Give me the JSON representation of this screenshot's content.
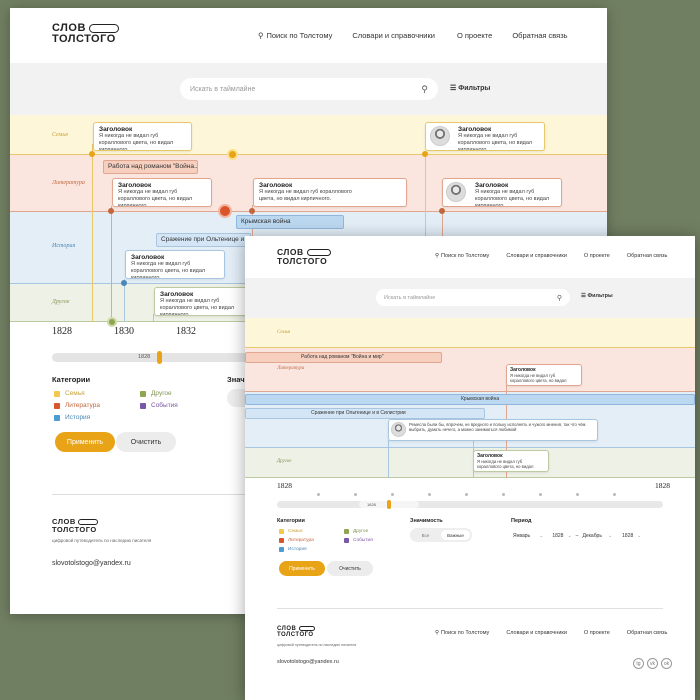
{
  "colors": {
    "background": "#707e61",
    "accent": "#e8a317",
    "family": "#fdf6d9",
    "literature": "#fbe6df",
    "history": "#e3eef7",
    "other": "#eef1e6"
  },
  "brand": {
    "line1": "СЛОВ",
    "line2": "ТОЛСТОГО",
    "tagline": "цифровой путеводитель по наследию писателя"
  },
  "nav": [
    "Поиск по Толстому",
    "Словари и справочники",
    "О проекте",
    "Обратная связь"
  ],
  "search": {
    "placeholder": "Искать в таймлайне",
    "filters": "Фильтры"
  },
  "bands": {
    "family": "Семья",
    "literature": "Литература",
    "history": "История",
    "other": "Другое"
  },
  "card": {
    "title": "Заголовок",
    "text": "Я никогда не видал губ кораллового цвета, но видал кирпичного."
  },
  "card_long": "Ремесла были бы, впрочем, не вредного и польку исполнять и чужого мнения, так что чём выбрать, думать нечего, а можно заниматься любимой",
  "events": {
    "novel_short": "Работа над романом \"Война...",
    "novel": "Работа над романом \"Война и мир\"",
    "crimea": "Крымская война",
    "battle_short": "Сражение при Ольтенице и в С...",
    "battle": "Сражение при Ольтенице и в Силистрии"
  },
  "years": [
    "1828",
    "1830",
    "1832",
    "1828",
    "1828"
  ],
  "slider": {
    "value": "1828"
  },
  "filters": {
    "categories_title": "Категории",
    "categories": [
      "Семья",
      "Литература",
      "История",
      "Другое",
      "События"
    ],
    "importance_title": "Значимость",
    "importance_short": "Значи",
    "importance": [
      "Все",
      "Важные"
    ],
    "period_title": "Период",
    "period": {
      "from_month": "Январь",
      "from_year": "1828",
      "dash": "–",
      "to_month": "Декабрь",
      "to_year": "1828"
    }
  },
  "buttons": {
    "apply": "Применить",
    "clear": "Очистить"
  },
  "footer": {
    "email": "slovotolstogo@yandex.ru",
    "social": [
      "tg",
      "vk",
      "ok"
    ]
  }
}
